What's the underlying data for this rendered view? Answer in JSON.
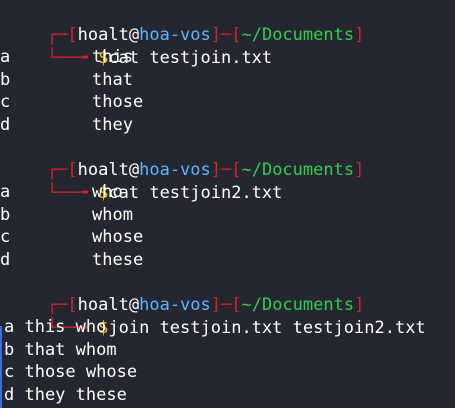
{
  "prompt": {
    "user": "hoalt",
    "at": "@",
    "host": "hoa-vos",
    "dir": "~/Documents"
  },
  "commands": [
    "cat testjoin.txt",
    "cat testjoin2.txt",
    "join testjoin.txt testjoin2.txt"
  ],
  "output1": [
    {
      "key": "a",
      "value": "this"
    },
    {
      "key": "b",
      "value": "that"
    },
    {
      "key": "c",
      "value": "those"
    },
    {
      "key": "d",
      "value": "they"
    }
  ],
  "output2": [
    {
      "key": "a",
      "value": "who"
    },
    {
      "key": "b",
      "value": "whom"
    },
    {
      "key": "c",
      "value": "whose"
    },
    {
      "key": "d",
      "value": "these"
    }
  ],
  "output3": [
    "a this who",
    "b that whom",
    "c those whose",
    "d they these"
  ],
  "colors": {
    "background": "#24272f",
    "prompt_frame": "#d6202a",
    "host": "#5bb6ff",
    "cwd": "#2fcf4a",
    "dollar": "#f4c400",
    "text": "#ffffff"
  }
}
